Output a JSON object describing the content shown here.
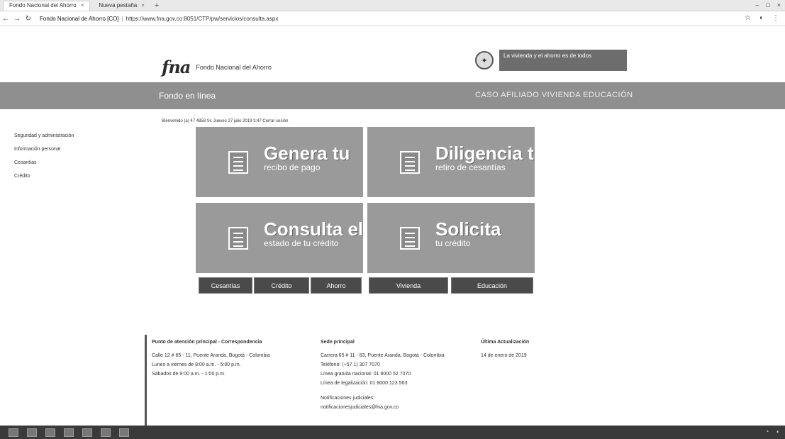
{
  "browser": {
    "tabs": [
      {
        "label": "Fondo Nacional del Ahorro",
        "active": true
      },
      {
        "label": "Nueva pestaña",
        "active": false
      }
    ],
    "url_site": "Fondo Nacional de Ahorro [CO]",
    "url": "https://www.fna.gov.co:8051/CTP/pw/servicios/consulta.aspx"
  },
  "header": {
    "logo_text": "fna",
    "name": "Fondo Nacional del Ahorro",
    "gov_text": "La vivienda y el ahorro es de todos"
  },
  "banner": {
    "left": "Fondo en línea",
    "right": "CASO AFILIADO VIVIENDA EDUCACIÓN"
  },
  "welcome": "Bienvenido (a) 47 4858 Sr.  Jueves 27 julio 2019 3:47   Cerrar sesión",
  "sidebar": [
    "Seguridad y administración",
    "Información personal",
    "Cesantías",
    "Crédito"
  ],
  "tiles": [
    {
      "big": "Genera tu",
      "small": "recibo de pago"
    },
    {
      "big": "Diligencia tu",
      "small": "retiro de cesantías"
    },
    {
      "big": "Consulta el",
      "small": "estado de tu crédito"
    },
    {
      "big": "Solicita",
      "small": "tu crédito"
    }
  ],
  "subbuttons": [
    "Cesantías",
    "Crédito",
    "Ahorro",
    "Vivienda",
    "Educación"
  ],
  "footer": {
    "col1_title": "Punto de atención principal - Correspondencia",
    "col1_lines": [
      "Calle 12 # 65 - 11, Puente Aranda, Bogotá - Colombia",
      "Lunes a viernes de 8:00 a.m. - 5:00 p.m.",
      "Sábados de 9:00 a.m. - 1:00 p.m."
    ],
    "col2_title": "Sede principal",
    "col2_lines": [
      "Carrera 65 # 11 - 83, Puente Aranda, Bogotá - Colombia",
      "Teléfono: (+57 1) 307 7070",
      "Línea gratuita nacional: 01 8000 52 7070",
      "Línea de legalización: 01 8000 123 563",
      "",
      "Notificaciones judiciales:",
      "notificacionesjudiciales@fna.gov.co"
    ],
    "col3_title": "Última Actualización",
    "col3_lines": [
      "14 de enero de 2019"
    ]
  }
}
